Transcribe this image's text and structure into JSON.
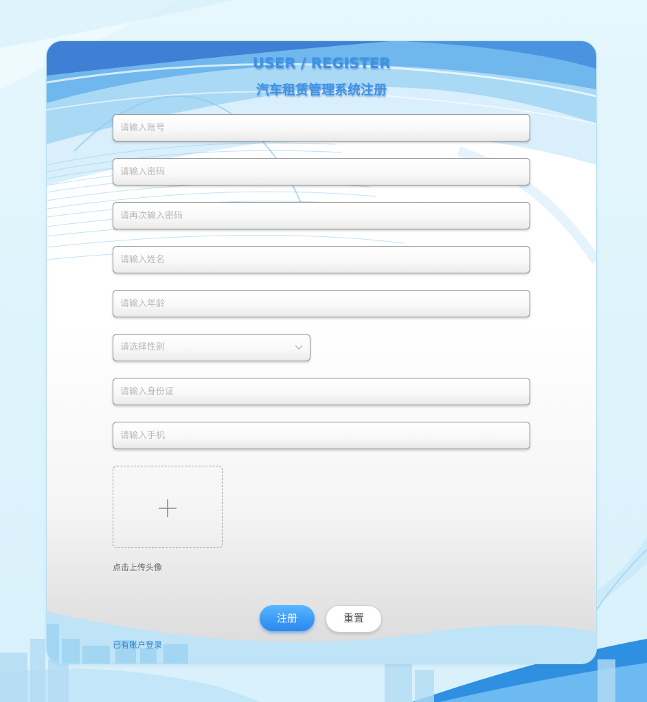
{
  "header": {
    "title_en": "USER / REGISTER",
    "title_cn": "汽车租赁管理系统注册"
  },
  "form": {
    "account_placeholder": "请输入账号",
    "password_placeholder": "请输入密码",
    "confirm_password_placeholder": "请再次输入密码",
    "name_placeholder": "请输入姓名",
    "age_placeholder": "请输入年龄",
    "gender_select_placeholder": "请选择性别",
    "id_card_placeholder": "请输入身份证",
    "phone_placeholder": "请输入手机",
    "avatar_upload_label": "点击上传头像"
  },
  "actions": {
    "register_label": "注册",
    "reset_label": "重置",
    "login_link": "已有账户登录"
  },
  "colors": {
    "accent": "#3d93e6",
    "primary_button": "#3a98f6",
    "link": "#2f7fd0",
    "page_background": "#dff4fc"
  },
  "icons": {
    "select_arrow": "chevron-down-icon",
    "upload": "plus-icon"
  }
}
